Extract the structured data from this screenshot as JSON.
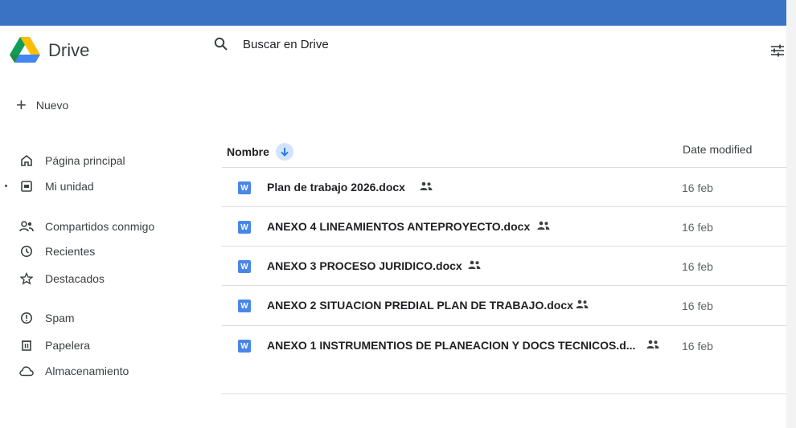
{
  "app": {
    "name": "Drive"
  },
  "sidebar": {
    "new_label": "Nuevo",
    "items": [
      {
        "label": "Página principal",
        "icon": "home-icon"
      },
      {
        "label": "Mi unidad",
        "icon": "my-drive-icon"
      },
      {
        "label": "Compartidos conmigo",
        "icon": "shared-icon"
      },
      {
        "label": "Recientes",
        "icon": "clock-icon"
      },
      {
        "label": "Destacados",
        "icon": "star-icon"
      },
      {
        "label": "Spam",
        "icon": "spam-icon"
      },
      {
        "label": "Papelera",
        "icon": "trash-icon"
      },
      {
        "label": "Almacenamiento",
        "icon": "cloud-icon"
      }
    ]
  },
  "search": {
    "placeholder": "Buscar en Drive"
  },
  "list": {
    "columns": {
      "name": "Nombre",
      "modified": "Date modified"
    },
    "files": [
      {
        "name": "Plan de trabajo 2026.docx",
        "date": "16 feb",
        "type_badge": "W"
      },
      {
        "name": "ANEXO 4  LINEAMIENTOS ANTEPROYECTO.docx",
        "date": "16 feb",
        "type_badge": "W"
      },
      {
        "name": "ANEXO 3 PROCESO JURIDICO.docx",
        "date": "16 feb",
        "type_badge": "W"
      },
      {
        "name": "ANEXO 2 SITUACION PREDIAL PLAN DE TRABAJO.docx",
        "date": "16 feb",
        "type_badge": "W"
      },
      {
        "name": "ANEXO 1 INSTRUMENTIOS DE PLANEACION Y DOCS TECNICOS.d...",
        "date": "16 feb",
        "type_badge": "W"
      }
    ]
  },
  "colors": {
    "topbar": "#3a73c4",
    "accent": "#1a73e8",
    "word": "#4a86e8"
  }
}
